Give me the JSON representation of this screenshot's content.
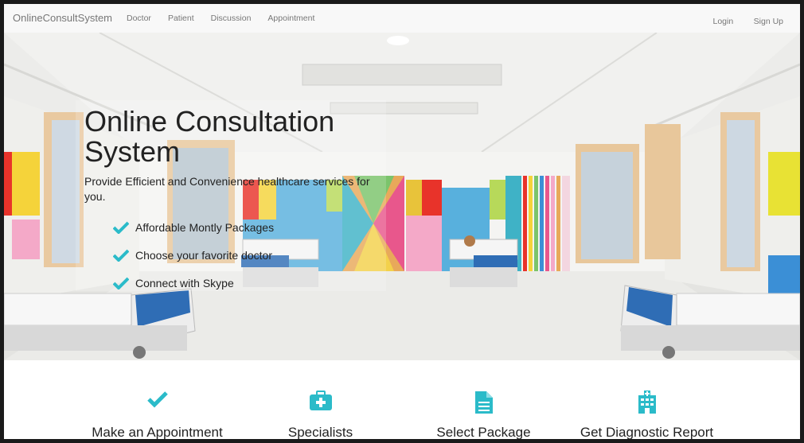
{
  "navbar": {
    "brand": "OnlineConsultSystem",
    "links": [
      "Doctor",
      "Patient",
      "Discussion",
      "Appointment"
    ],
    "right_links": [
      "Login",
      "Sign Up"
    ]
  },
  "hero": {
    "title": "Online Consultation System",
    "subtitle": "Provide Efficient and Convenience healthcare services for you.",
    "features": [
      "Affordable Montly Packages",
      "Choose your favorite doctor",
      "Connect with Skype"
    ]
  },
  "services": [
    {
      "label": "Make an Appointment",
      "icon": "check-icon"
    },
    {
      "label": "Specialists",
      "icon": "medkit-icon"
    },
    {
      "label": "Select Package",
      "icon": "document-icon"
    },
    {
      "label": "Get Diagnostic Report",
      "icon": "hospital-icon"
    }
  ],
  "colors": {
    "accent": "#2bbbc9",
    "navbar_bg": "#f8f8f8",
    "nav_text": "#777777"
  }
}
